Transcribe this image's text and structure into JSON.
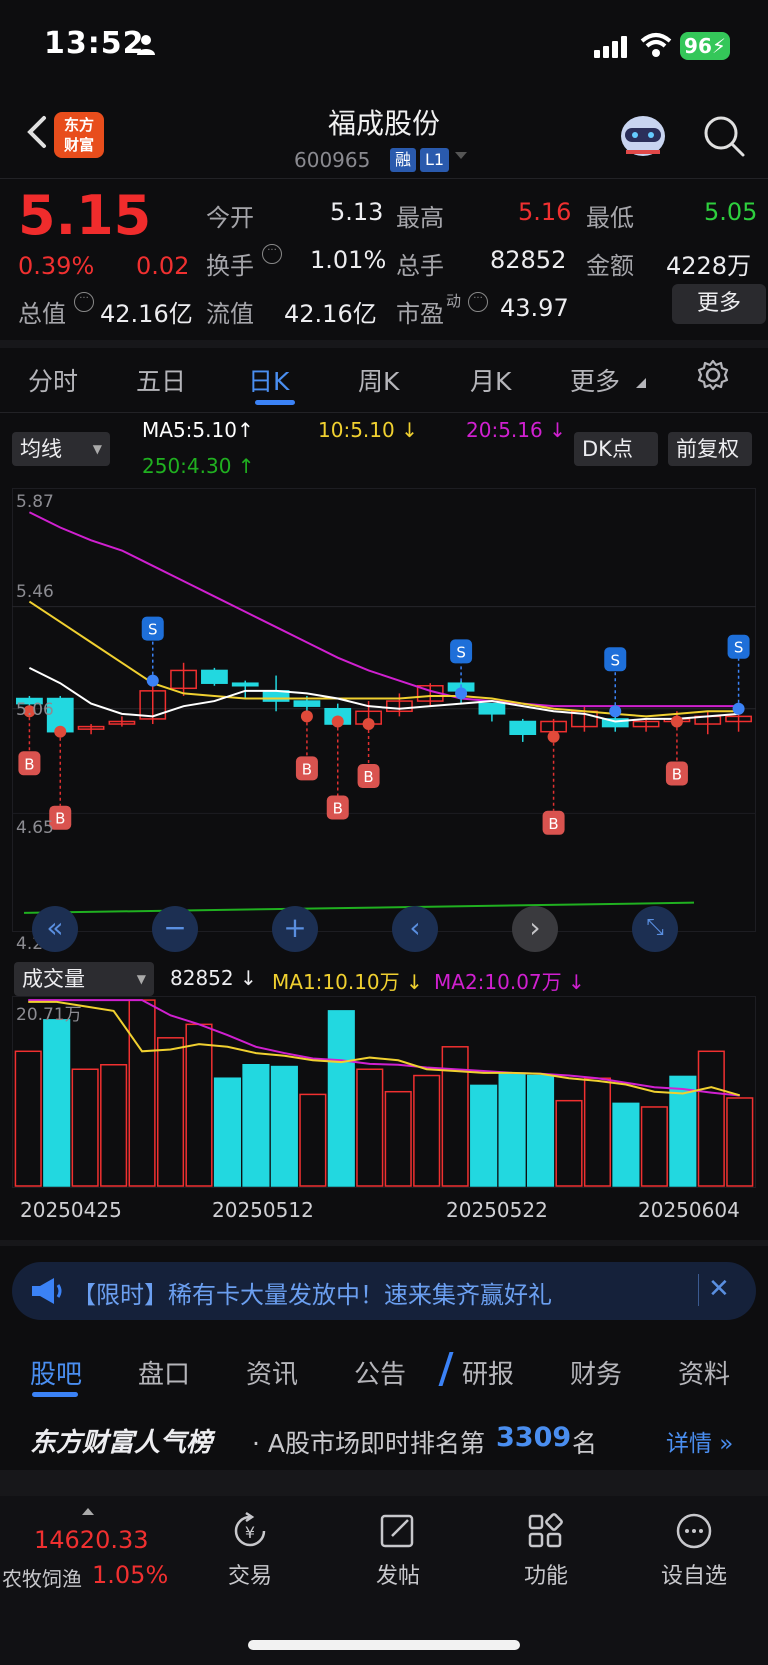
{
  "status": {
    "time": "13:52",
    "battery": "96"
  },
  "header": {
    "logo_line1": "东方",
    "logo_line2": "财富",
    "stock_name": "福成股份",
    "stock_code": "600965",
    "tag1": "融",
    "tag2": "L1"
  },
  "quote": {
    "price": "5.15",
    "change_pct": "0.39%",
    "change": "0.02",
    "open_label": "今开",
    "open": "5.13",
    "high_label": "最高",
    "high": "5.16",
    "low_label": "最低",
    "low": "5.05",
    "turnover_label": "换手",
    "turnover": "1.01%",
    "volume_label": "总手",
    "volume": "82852",
    "amount_label": "金额",
    "amount": "4228万",
    "mktcap_label": "总值",
    "mktcap": "42.16亿",
    "float_label": "流值",
    "float": "42.16亿",
    "pe_label": "市盈",
    "pe_sup": "动",
    "pe": "43.97",
    "more": "更多"
  },
  "period_tabs": [
    "分时",
    "五日",
    "日K",
    "周K",
    "月K",
    "更多"
  ],
  "chart_controls": {
    "ma_select": "均线",
    "ma5": "MA5:5.10",
    "ma10": "10:5.10",
    "ma20": "20:5.16",
    "ma250": "250:4.30",
    "dk_button": "DK点",
    "adjust_button": "前复权"
  },
  "price_axis": [
    "5.87",
    "5.46",
    "5.06",
    "4.65",
    "4.24"
  ],
  "volume_controls": {
    "select": "成交量",
    "value": "82852",
    "ma1": "MA1:10.10万",
    "ma2": "MA2:10.07万",
    "max_label": "20.71万"
  },
  "date_labels": [
    "20250425",
    "20250512",
    "20250522",
    "20250604"
  ],
  "colors": {
    "up": "#f03030",
    "down": "#22d8e0",
    "ma5": "#ffffff",
    "ma10": "#f0d030",
    "ma20": "#d020d0",
    "ma250": "#20b020",
    "accent": "#3b82f6"
  },
  "chart_data": {
    "type": "candlestick",
    "ylim": [
      4.24,
      5.87
    ],
    "candles": [
      {
        "o": 5.1,
        "c": 5.08,
        "h": 5.11,
        "l": 5.03
      },
      {
        "o": 5.1,
        "c": 4.97,
        "h": 5.11,
        "l": 4.95
      },
      {
        "o": 4.98,
        "c": 4.99,
        "h": 5.0,
        "l": 4.96
      },
      {
        "o": 5.0,
        "c": 5.01,
        "h": 5.03,
        "l": 4.99
      },
      {
        "o": 5.02,
        "c": 5.13,
        "h": 5.15,
        "l": 5.0
      },
      {
        "o": 5.14,
        "c": 5.21,
        "h": 5.24,
        "l": 5.11
      },
      {
        "o": 5.21,
        "c": 5.16,
        "h": 5.22,
        "l": 5.15
      },
      {
        "o": 5.16,
        "c": 5.15,
        "h": 5.17,
        "l": 5.1
      },
      {
        "o": 5.13,
        "c": 5.09,
        "h": 5.19,
        "l": 5.05
      },
      {
        "o": 5.09,
        "c": 5.07,
        "h": 5.11,
        "l": 5.01
      },
      {
        "o": 5.06,
        "c": 5.0,
        "h": 5.08,
        "l": 4.99
      },
      {
        "o": 5.0,
        "c": 5.05,
        "h": 5.09,
        "l": 4.98
      },
      {
        "o": 5.05,
        "c": 5.09,
        "h": 5.12,
        "l": 5.03
      },
      {
        "o": 5.09,
        "c": 5.15,
        "h": 5.16,
        "l": 5.07
      },
      {
        "o": 5.16,
        "c": 5.13,
        "h": 5.17,
        "l": 5.08
      },
      {
        "o": 5.08,
        "c": 5.04,
        "h": 5.08,
        "l": 5.01
      },
      {
        "o": 5.01,
        "c": 4.96,
        "h": 5.02,
        "l": 4.93
      },
      {
        "o": 4.97,
        "c": 5.01,
        "h": 5.02,
        "l": 4.93
      },
      {
        "o": 4.99,
        "c": 5.05,
        "h": 5.07,
        "l": 4.97
      },
      {
        "o": 5.02,
        "c": 4.99,
        "h": 5.03,
        "l": 4.97
      },
      {
        "o": 4.99,
        "c": 5.01,
        "h": 5.02,
        "l": 4.97
      },
      {
        "o": 5.01,
        "c": 5.02,
        "h": 5.05,
        "l": 4.99
      },
      {
        "o": 5.0,
        "c": 5.03,
        "h": 5.05,
        "l": 4.96
      },
      {
        "o": 5.01,
        "c": 5.03,
        "h": 5.04,
        "l": 4.97
      }
    ],
    "ma5": [
      5.22,
      5.16,
      5.08,
      5.04,
      5.03,
      5.07,
      5.09,
      5.13,
      5.13,
      5.12,
      5.1,
      5.07,
      5.06,
      5.07,
      5.08,
      5.09,
      5.07,
      5.05,
      5.04,
      5.01,
      5.02,
      5.02,
      5.03,
      5.04
    ],
    "ma10": [
      5.48,
      5.4,
      5.32,
      5.24,
      5.16,
      5.12,
      5.11,
      5.1,
      5.1,
      5.1,
      5.1,
      5.1,
      5.1,
      5.11,
      5.11,
      5.1,
      5.08,
      5.06,
      5.05,
      5.04,
      5.03,
      5.04,
      5.05,
      5.05
    ],
    "ma20": [
      5.83,
      5.77,
      5.72,
      5.68,
      5.62,
      5.56,
      5.5,
      5.44,
      5.38,
      5.32,
      5.26,
      5.21,
      5.17,
      5.13,
      5.1,
      5.09,
      5.08,
      5.07,
      5.07,
      5.07,
      5.07,
      5.07,
      5.07,
      5.07
    ],
    "ma250": [
      4.26,
      4.3
    ],
    "signals_S": [
      4,
      14,
      19,
      24
    ],
    "signals_B": [
      0,
      1,
      9,
      10,
      11,
      17,
      21
    ],
    "volume_max": 20.71,
    "volumes": [
      15.0,
      18.5,
      13.0,
      13.5,
      20.7,
      16.5,
      18.0,
      12.0,
      13.5,
      13.3,
      10.2,
      19.5,
      13.0,
      10.5,
      12.3,
      15.5,
      11.2,
      12.5,
      12.3,
      9.5,
      12.0,
      9.2,
      8.8,
      12.2,
      15.0,
      9.8
    ],
    "volume_up": [
      true,
      false,
      true,
      true,
      true,
      true,
      true,
      false,
      false,
      false,
      true,
      false,
      true,
      true,
      true,
      true,
      false,
      false,
      false,
      true,
      true,
      false,
      true,
      false,
      true,
      true
    ],
    "vol_ma1": [
      20.5,
      20.5,
      20.0,
      19.5,
      15.0,
      15.2,
      15.8,
      15.5,
      14.8,
      14.5,
      14.0,
      13.8,
      14.3,
      14.0,
      13.0,
      12.8,
      12.6,
      12.6,
      12.5,
      12.0,
      11.7,
      11.3,
      10.5,
      10.3,
      11.0,
      10.1
    ],
    "vol_ma2": [
      20.7,
      20.7,
      20.7,
      20.7,
      20.7,
      19.0,
      18.0,
      16.8,
      15.5,
      14.8,
      14.2,
      14.0,
      13.6,
      13.5,
      13.2,
      13.0,
      12.8,
      12.6,
      12.5,
      12.3,
      12.0,
      11.5,
      11.0,
      10.8,
      10.4,
      10.07
    ]
  },
  "banner": {
    "text": "【限时】稀有卡大量发放中！速来集齐赢好礼"
  },
  "section_tabs": [
    "股吧",
    "盘口",
    "资讯",
    "公告",
    "研报",
    "财务",
    "资料"
  ],
  "rank": {
    "brand": "东方财富人气榜",
    "text": "· A股市场即时排名第",
    "number": "3309",
    "after": "名",
    "detail": "详情"
  },
  "bottom": {
    "index_value": "14620.33",
    "index_name": "农牧饲渔",
    "index_change": "1.05%",
    "nav": [
      "交易",
      "发帖",
      "功能",
      "设自选"
    ]
  }
}
